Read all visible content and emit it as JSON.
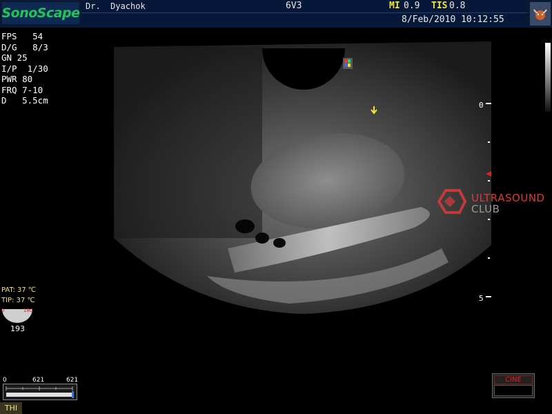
{
  "brand": "SonoScape",
  "header": {
    "doctor": "Dr.  Dyachok",
    "probe": "6V3",
    "mi_label": "MI",
    "mi_value": "0.9",
    "tis_label": "TIS",
    "tis_value": "0.8",
    "datetime": "8/Feb/2010 10:12:55"
  },
  "params": [
    {
      "label": "FPS",
      "value": "54"
    },
    {
      "label": "D/G",
      "value": " 8/3"
    },
    {
      "label": "GN",
      "value": "25"
    },
    {
      "label": "I/P",
      "value": "1/30"
    },
    {
      "label": "PWR",
      "value": "80"
    },
    {
      "label": "FRQ",
      "value": "7-10"
    },
    {
      "label": "D",
      "value": "5.5cm"
    }
  ],
  "depth_scale": {
    "top": "0",
    "bottom": "5"
  },
  "watermark": {
    "line1": "ULTRASOUND",
    "line2": "CLUB"
  },
  "temps": {
    "pat_label": "PAT:",
    "pat_value": "37 ℃",
    "tip_label": "TIP:",
    "tip_value": "37 ℃",
    "angle_min": "0",
    "angle_max": "180",
    "angle_value": "193"
  },
  "cine": {
    "label": "CINE"
  },
  "cine_slider": {
    "min": "0",
    "mid": "621",
    "max": "621"
  },
  "mode_label": "THI",
  "colors": {
    "brand": "#22c45a",
    "accent_yellow": "#f5e63a",
    "watermark_red": "#d93a3a"
  }
}
